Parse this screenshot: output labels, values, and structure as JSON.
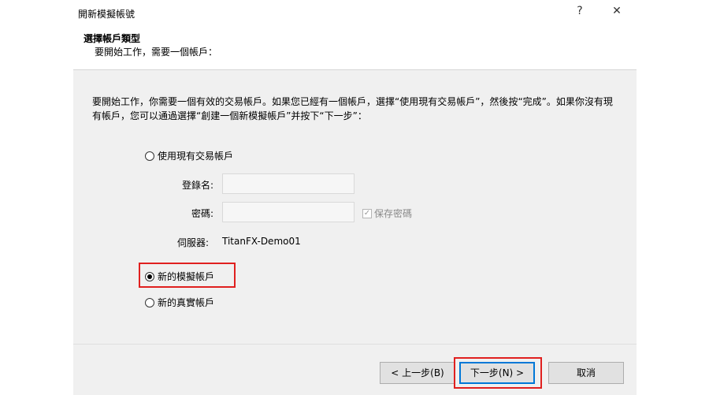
{
  "window": {
    "title": "開新模擬帳號",
    "help_glyph": "?",
    "close_glyph": "✕"
  },
  "header": {
    "title": "選擇帳戶類型",
    "subtitle": "要開始工作，需要一個帳戶："
  },
  "intro": "要開始工作，你需要一個有效的交易帳戶。如果您已經有一個帳戶，選擇“使用現有交易帳戶”，然後按“完成”。如果你沒有現有帳戶，您可以通過選擇“創建一個新模擬帳戶”并按下“下一步”：",
  "options": {
    "existing": {
      "label": "使用現有交易帳戶",
      "selected": false
    },
    "demo": {
      "label": "新的模擬帳戶",
      "selected": true
    },
    "real": {
      "label": "新的真實帳戶",
      "selected": false
    }
  },
  "form": {
    "login_label": "登錄名:",
    "login_value": "",
    "password_label": "密碼:",
    "password_value": "",
    "save_password_label": "保存密碼",
    "save_password_checked": true,
    "server_label": "伺服器:",
    "server_value": "TitanFX-Demo01"
  },
  "buttons": {
    "back": "< 上一步(B)",
    "next": "下一步(N) >",
    "cancel": "取消"
  },
  "highlight_color": "#e0201f"
}
